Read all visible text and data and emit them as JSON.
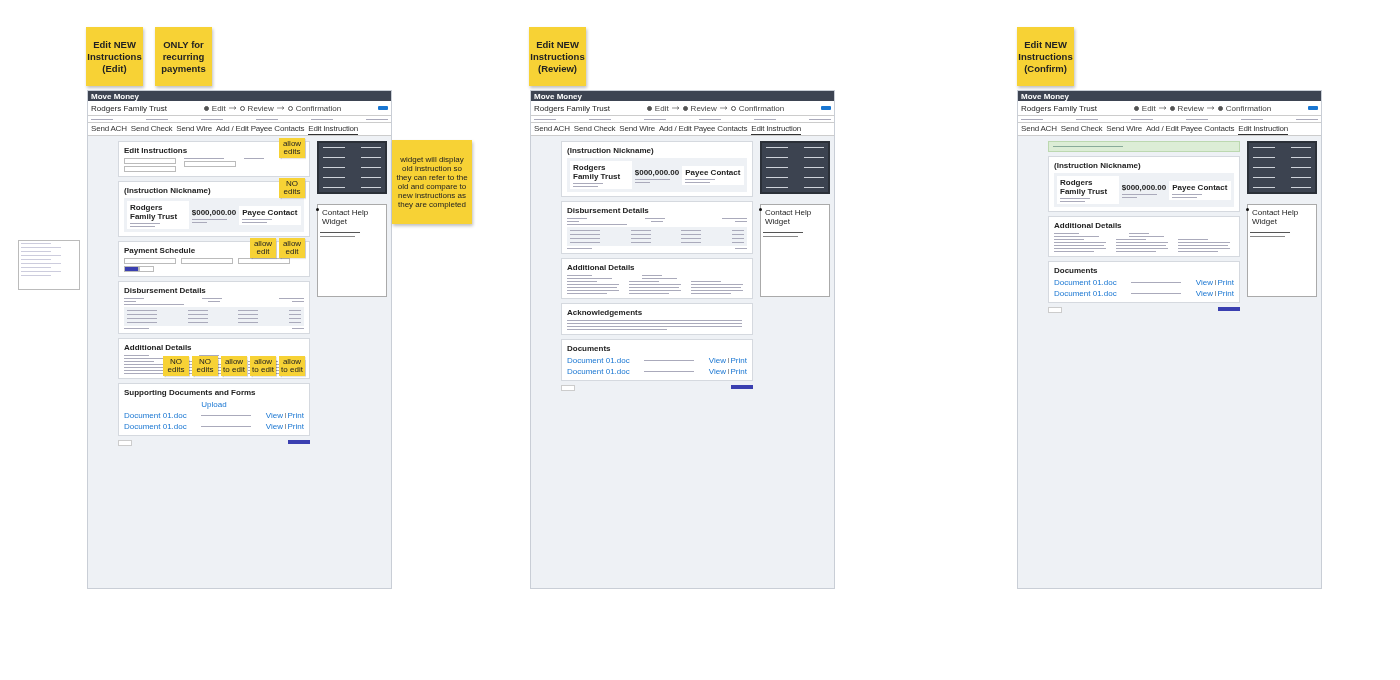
{
  "frames": [
    {
      "stickies": [
        {
          "text": "Edit NEW Instructions (Edit)"
        },
        {
          "text": "ONLY for recurring payments"
        }
      ],
      "header": "Move Money",
      "title": "Rodgers Family Trust",
      "steps": [
        {
          "label": "Edit",
          "done": true
        },
        {
          "label": "Review",
          "done": false
        },
        {
          "label": "Confirmation",
          "done": false
        }
      ],
      "tabs": [
        {
          "label": "Send ACH",
          "selected": false
        },
        {
          "label": "Send Check",
          "selected": false
        },
        {
          "label": "Send Wire",
          "selected": false
        },
        {
          "label": "Add / Edit Payee Contacts",
          "selected": false
        },
        {
          "label": "Edit Instruction",
          "selected": true
        }
      ],
      "cards": [
        {
          "kind": "edit-form",
          "title": "Edit Instructions",
          "notes": [
            "allow edits"
          ]
        },
        {
          "kind": "transfer",
          "title": "(Instruction Nickname)",
          "from": "Rodgers Family Trust",
          "amount": "$000,000.00",
          "to": "Payee Contact",
          "notes": [
            "NO edits"
          ]
        },
        {
          "kind": "schedule",
          "title": "Payment Schedule",
          "notes": [
            "allow edit",
            "allow edit"
          ]
        },
        {
          "kind": "disbursement",
          "title": "Disbursement Details"
        },
        {
          "kind": "details",
          "title": "Additional Details",
          "notes": [
            "NO edits",
            "NO edits",
            "allow to edit",
            "allow to edit",
            "allow to edit"
          ]
        },
        {
          "kind": "documents",
          "title": "Supporting Documents and Forms",
          "upload": "Upload",
          "files": [
            {
              "name": "Document 01.doc",
              "actions": [
                "View",
                "Print"
              ]
            },
            {
              "name": "Document 01.doc",
              "actions": [
                "View",
                "Print"
              ]
            }
          ]
        }
      ],
      "help": {
        "title": "Contact Help Widget"
      }
    },
    {
      "stickies": [
        {
          "text": "Edit NEW Instructions (Review)"
        }
      ],
      "header": "Move Money",
      "title": "Rodgers Family Trust",
      "steps": [
        {
          "label": "Edit",
          "done": true
        },
        {
          "label": "Review",
          "done": true
        },
        {
          "label": "Confirmation",
          "done": false
        }
      ],
      "tabs": [
        {
          "label": "Send ACH",
          "selected": false
        },
        {
          "label": "Send Check",
          "selected": false
        },
        {
          "label": "Send Wire",
          "selected": false
        },
        {
          "label": "Add / Edit Payee Contacts",
          "selected": false
        },
        {
          "label": "Edit Instruction",
          "selected": true
        }
      ],
      "cards": [
        {
          "kind": "transfer",
          "title": "(Instruction Nickname)",
          "from": "Rodgers Family Trust",
          "amount": "$000,000.00",
          "to": "Payee Contact"
        },
        {
          "kind": "disbursement",
          "title": "Disbursement Details"
        },
        {
          "kind": "details",
          "title": "Additional Details"
        },
        {
          "kind": "acknowledgements",
          "title": "Acknowledgements"
        },
        {
          "kind": "documents",
          "title": "Documents",
          "files": [
            {
              "name": "Document 01.doc",
              "actions": [
                "View",
                "Print"
              ]
            },
            {
              "name": "Document 01.doc",
              "actions": [
                "View",
                "Print"
              ]
            }
          ]
        }
      ],
      "help": {
        "title": "Contact Help Widget"
      }
    },
    {
      "stickies": [
        {
          "text": "Edit NEW Instructions (Confirm)"
        }
      ],
      "header": "Move Money",
      "title": "Rodgers Family Trust",
      "steps": [
        {
          "label": "Edit",
          "done": true
        },
        {
          "label": "Review",
          "done": true
        },
        {
          "label": "Confirmation",
          "done": true
        }
      ],
      "tabs": [
        {
          "label": "Send ACH",
          "selected": false
        },
        {
          "label": "Send Check",
          "selected": false
        },
        {
          "label": "Send Wire",
          "selected": false
        },
        {
          "label": "Add / Edit Payee Contacts",
          "selected": false
        },
        {
          "label": "Edit Instruction",
          "selected": true
        }
      ],
      "cards": [
        {
          "kind": "banner"
        },
        {
          "kind": "transfer",
          "title": "(Instruction Nickname)",
          "from": "Rodgers Family Trust",
          "amount": "$000,000.00",
          "to": "Payee Contact"
        },
        {
          "kind": "details",
          "title": "Additional Details"
        },
        {
          "kind": "documents",
          "title": "Documents",
          "files": [
            {
              "name": "Document 01.doc",
              "actions": [
                "View",
                "Print"
              ]
            },
            {
              "name": "Document 01.doc",
              "actions": [
                "View",
                "Print"
              ]
            }
          ]
        }
      ],
      "help": {
        "title": "Contact Help Widget"
      }
    }
  ],
  "side_note": "widget will display old instruction so they can refer to the old and compare to new instructions as they are completed"
}
